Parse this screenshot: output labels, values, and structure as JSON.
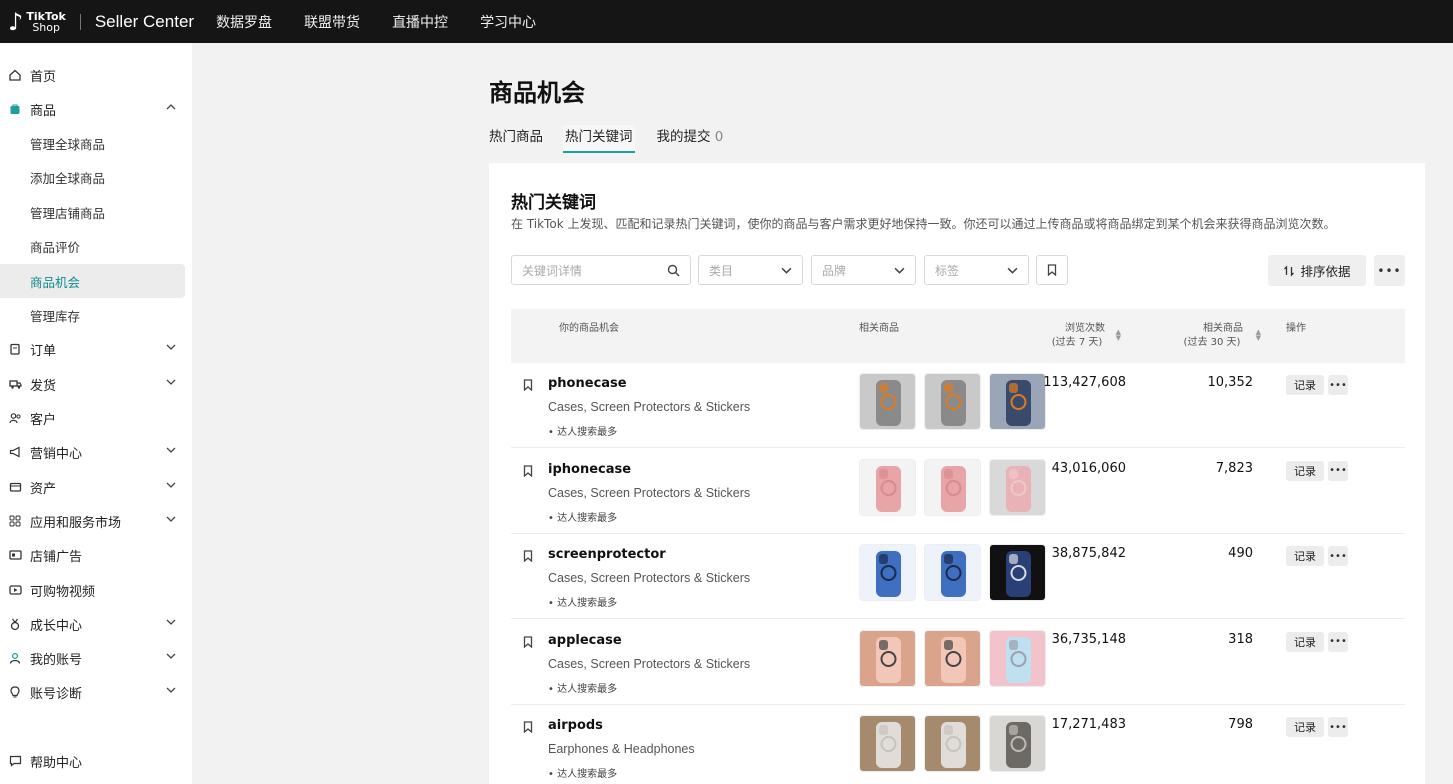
{
  "topbar": {
    "logo_line1": "TikTok",
    "logo_line2": "Shop",
    "seller_center": "Seller Center",
    "nav": [
      "数据罗盘",
      "联盟带货",
      "直播中控",
      "学习中心"
    ]
  },
  "sidebar": {
    "items": [
      {
        "label": "首页",
        "icon": "home-icon"
      },
      {
        "label": "商品",
        "icon": "product-icon",
        "expanded": true
      },
      {
        "label": "管理全球商品",
        "sub": true
      },
      {
        "label": "添加全球商品",
        "sub": true
      },
      {
        "label": "管理店铺商品",
        "sub": true
      },
      {
        "label": "商品评价",
        "sub": true
      },
      {
        "label": "商品机会",
        "sub": true,
        "active": true
      },
      {
        "label": "管理库存",
        "sub": true
      },
      {
        "label": "订单",
        "icon": "order-icon",
        "chevron": true
      },
      {
        "label": "发货",
        "icon": "truck-icon",
        "chevron": true
      },
      {
        "label": "客户",
        "icon": "customer-icon"
      },
      {
        "label": "营销中心",
        "icon": "megaphone-icon",
        "chevron": true
      },
      {
        "label": "资产",
        "icon": "wallet-icon",
        "chevron": true
      },
      {
        "label": "应用和服务市场",
        "icon": "apps-icon",
        "chevron": true
      },
      {
        "label": "店铺广告",
        "icon": "ads-icon"
      },
      {
        "label": "可购物视频",
        "icon": "video-icon"
      },
      {
        "label": "成长中心",
        "icon": "medal-icon",
        "chevron": true
      },
      {
        "label": "我的账号",
        "icon": "account-icon",
        "chevron": true
      },
      {
        "label": "账号诊断",
        "icon": "diagnosis-icon",
        "chevron": true
      }
    ],
    "help": "帮助中心"
  },
  "main": {
    "title": "商品机会",
    "tabs": [
      {
        "label": "热门商品"
      },
      {
        "label": "热门关键词",
        "active": true
      },
      {
        "label": "我的提交",
        "count": "0"
      }
    ],
    "card": {
      "title": "热门关键词",
      "description": "在 TikTok 上发现、匹配和记录热门关键词，使你的商品与客户需求更好地保持一致。你还可以通过上传商品或将商品绑定到某个机会来获得商品浏览次数。",
      "search_placeholder": "关键词详情",
      "filters": [
        "类目",
        "品牌",
        "标签"
      ],
      "sort_label": "排序依据",
      "columns": {
        "opportunity": "你的商品机会",
        "related_products": "相关商品",
        "views": "浏览次数",
        "views_sub": "(过去 7 天)",
        "related_count": "相关商品",
        "related_count_sub": "(过去 30 天)",
        "actions": "操作"
      },
      "rows": [
        {
          "keyword": "phonecase",
          "category": "Cases, Screen Protectors & Stickers",
          "tag": "• 达人搜索最多",
          "views": "113,427,608",
          "related": "10,352",
          "record": "记录",
          "thumbs": [
            "magsafe-case",
            "magsafe-case",
            "magsafe-case-blue"
          ]
        },
        {
          "keyword": "iphonecase",
          "category": "Cases, Screen Protectors & Stickers",
          "tag": "• 达人搜索最多",
          "views": "43,016,060",
          "related": "7,823",
          "record": "记录",
          "thumbs": [
            "pink-case",
            "pink-case",
            "pink-case-flat"
          ]
        },
        {
          "keyword": "screenprotector",
          "category": "Cases, Screen Protectors & Stickers",
          "tag": "• 达人搜索最多",
          "views": "38,875,842",
          "related": "490",
          "record": "记录",
          "thumbs": [
            "screen-protector",
            "screen-protector",
            "protector-box"
          ]
        },
        {
          "keyword": "applecase",
          "category": "Cases, Screen Protectors & Stickers",
          "tag": "• 达人搜索最多",
          "views": "36,735,148",
          "related": "318",
          "record": "记录",
          "thumbs": [
            "rose-case",
            "rose-case",
            "pastel-case"
          ]
        },
        {
          "keyword": "airpods",
          "category": "Earphones & Headphones",
          "tag": "• 达人搜索最多",
          "views": "17,271,483",
          "related": "798",
          "record": "记录",
          "thumbs": [
            "headphones",
            "headphones",
            "earbuds"
          ]
        }
      ]
    }
  },
  "colors": {
    "accent": "#1f9e9e",
    "topbar": "#151515"
  }
}
